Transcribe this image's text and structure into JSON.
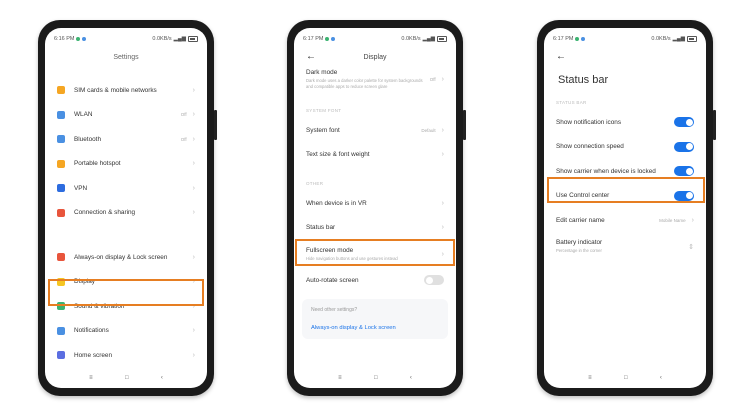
{
  "status_bars": [
    {
      "time": "6:16 PM",
      "speed": "0.0KB/s"
    },
    {
      "time": "6:17 PM",
      "speed": "0.0KB/s"
    },
    {
      "time": "6:17 PM",
      "speed": "0.0KB/s"
    }
  ],
  "phone1": {
    "title": "Settings",
    "items": [
      {
        "label": "SIM cards & mobile networks",
        "icon": "sim-card-icon",
        "color": "#f5a623",
        "value": ""
      },
      {
        "label": "WLAN",
        "icon": "wifi-icon",
        "color": "#4a90e2",
        "value": "Off"
      },
      {
        "label": "Bluetooth",
        "icon": "bluetooth-icon",
        "color": "#4a90e2",
        "value": "Off"
      },
      {
        "label": "Portable hotspot",
        "icon": "hotspot-icon",
        "color": "#f5a623",
        "value": ""
      },
      {
        "label": "VPN",
        "icon": "vpn-icon",
        "color": "#2d6cdf",
        "value": ""
      },
      {
        "label": "Connection & sharing",
        "icon": "sharing-icon",
        "color": "#e8553c",
        "value": ""
      }
    ],
    "items2": [
      {
        "label": "Always-on display & Lock screen",
        "icon": "lock-icon",
        "color": "#e8553c"
      },
      {
        "label": "Display",
        "icon": "sun-icon",
        "color": "#f5c623"
      },
      {
        "label": "Sound & vibration",
        "icon": "sound-icon",
        "color": "#3cb371"
      },
      {
        "label": "Notifications",
        "icon": "bell-icon",
        "color": "#4a90e2"
      },
      {
        "label": "Home screen",
        "icon": "home-icon",
        "color": "#5b6ee1"
      }
    ]
  },
  "phone2": {
    "title": "Display",
    "dark_mode": {
      "label": "Dark mode",
      "sub": "Dark mode uses a darker color palette for system backgrounds and compatible apps to reduce screen glare",
      "value": "Off"
    },
    "section_font": "SYSTEM FONT",
    "items_font": [
      {
        "label": "System font",
        "value": "Default"
      },
      {
        "label": "Text size & font weight",
        "value": ""
      }
    ],
    "section_other": "OTHER",
    "items_other": [
      {
        "label": "When device is in VR",
        "value": ""
      },
      {
        "label": "Status bar",
        "value": ""
      }
    ],
    "fullscreen": {
      "label": "Fullscreen mode",
      "sub": "Hide navigation buttons and use gestures instead"
    },
    "autorotate": {
      "label": "Auto-rotate screen"
    },
    "card": {
      "question": "Need other settings?",
      "link": "Always-on display & Lock screen"
    }
  },
  "phone3": {
    "title": "Status bar",
    "section": "STATUS BAR",
    "toggles": [
      {
        "label": "Show notification icons"
      },
      {
        "label": "Show connection speed"
      },
      {
        "label": "Show carrier when device is locked"
      },
      {
        "label": "Use Control center"
      }
    ],
    "carrier": {
      "label": "Edit carrier name",
      "value": "Mobile Name"
    },
    "battery": {
      "label": "Battery indicator",
      "sub": "Percentage in the corner"
    }
  },
  "nav": {
    "menu": "≡",
    "home": "□",
    "back": "‹"
  },
  "highlight_color": "#e67e22"
}
